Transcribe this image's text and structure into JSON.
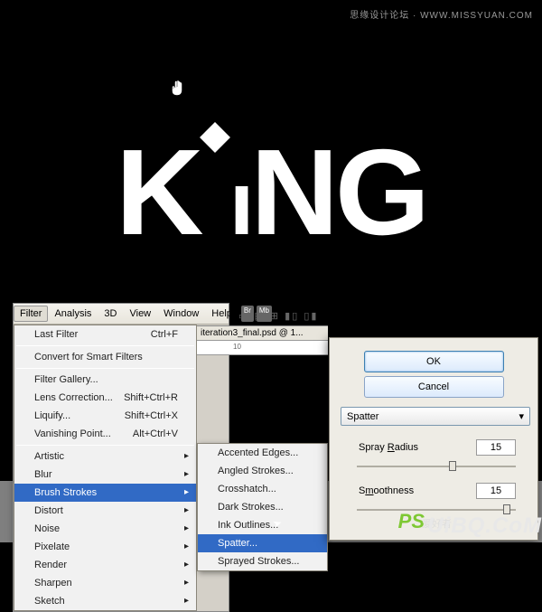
{
  "watermarks": {
    "top": "思缘设计论坛 · WWW.MISSYUAN.COM",
    "ps": "PS",
    "cn": "爱好者",
    "url": "UiBQ.CoM"
  },
  "canvas": {
    "text_parts": [
      "K",
      "N",
      "G"
    ],
    "lowercase_i": "ı"
  },
  "menubar": {
    "items": [
      "Filter",
      "Analysis",
      "3D",
      "View",
      "Window",
      "Help"
    ],
    "badges": [
      "Br",
      "Mb"
    ]
  },
  "doc": {
    "title": "iteration3_final.psd @ 1...",
    "ruler": "10"
  },
  "toolbar_glyphs": "▭ ▦ ⊞  ▮▯ ▯▮",
  "filter_menu": {
    "last_filter": "Last Filter",
    "last_filter_key": "Ctrl+F",
    "convert": "Convert for Smart Filters",
    "gallery": "Filter Gallery...",
    "lens": "Lens Correction...",
    "lens_key": "Shift+Ctrl+R",
    "liquify": "Liquify...",
    "liquify_key": "Shift+Ctrl+X",
    "vanishing": "Vanishing Point...",
    "vanishing_key": "Alt+Ctrl+V",
    "categories": [
      "Artistic",
      "Blur",
      "Brush Strokes",
      "Distort",
      "Noise",
      "Pixelate",
      "Render",
      "Sharpen",
      "Sketch"
    ]
  },
  "submenu": {
    "items": [
      "Accented Edges...",
      "Angled Strokes...",
      "Crosshatch...",
      "Dark Strokes...",
      "Ink Outlines...",
      "Spatter...",
      "Sprayed Strokes..."
    ]
  },
  "dialog": {
    "ok": "OK",
    "cancel": "Cancel",
    "filter_name": "Spatter",
    "param1_label_pre": "Spray ",
    "param1_label_u": "R",
    "param1_label_post": "adius",
    "param1_value": "15",
    "param2_label_pre": "S",
    "param2_label_u": "m",
    "param2_label_post": "oothness",
    "param2_value": "15"
  }
}
